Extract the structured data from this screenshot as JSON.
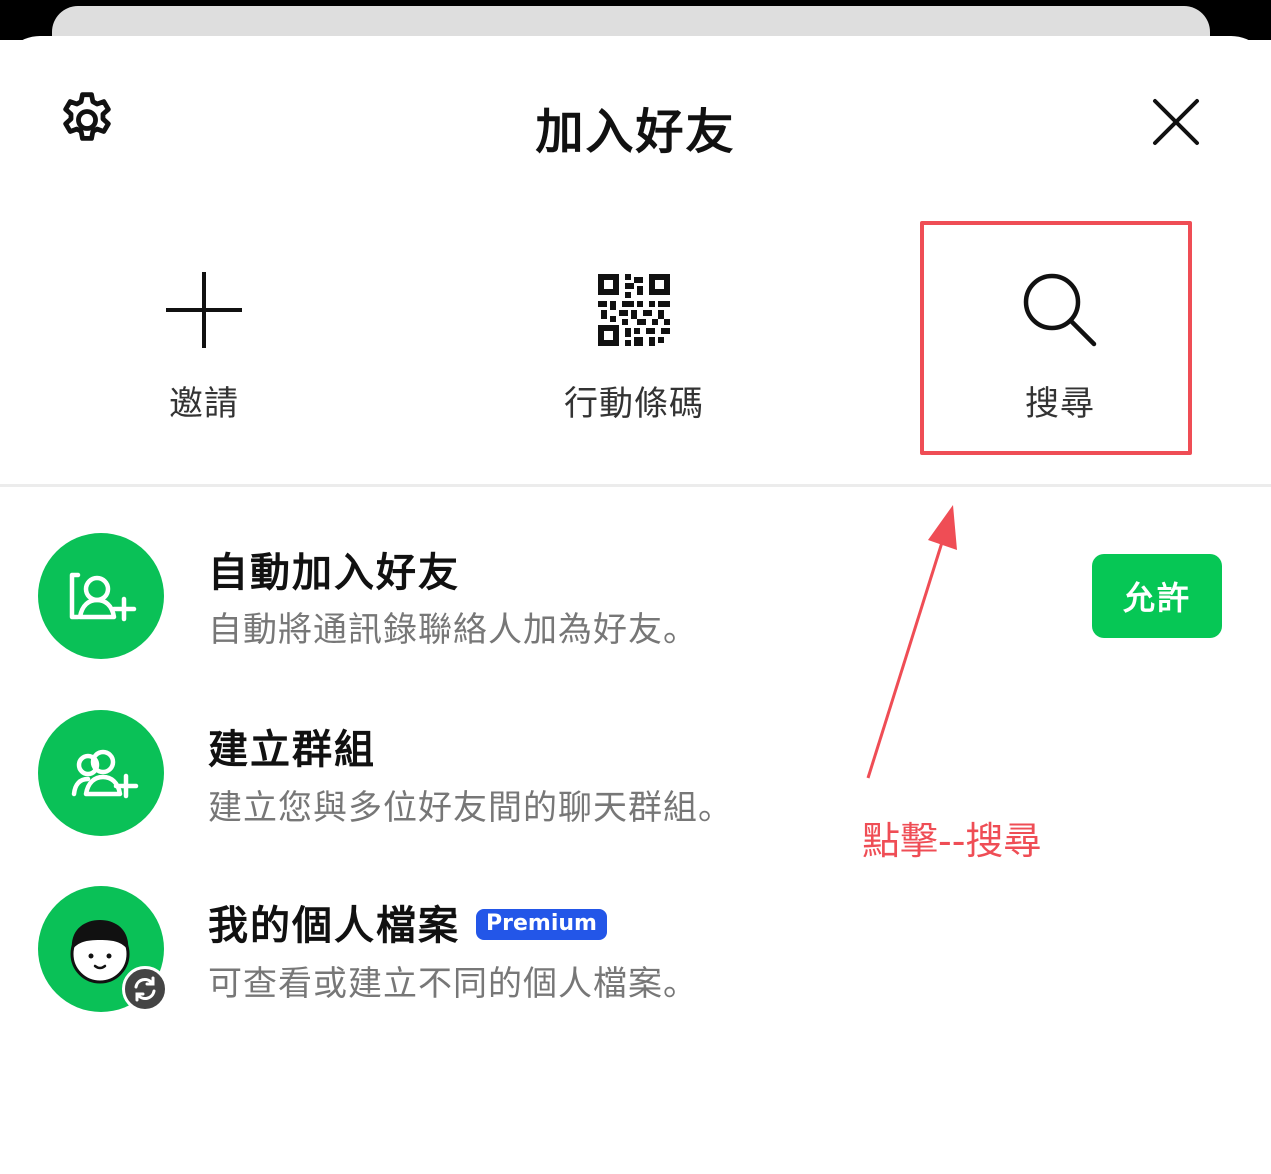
{
  "header": {
    "title": "加入好友",
    "settings_icon": "gear-icon",
    "close_icon": "close-icon"
  },
  "actions": [
    {
      "label": "邀請",
      "icon": "plus-icon"
    },
    {
      "label": "行動條碼",
      "icon": "qr-code-icon"
    },
    {
      "label": "搜尋",
      "icon": "search-icon"
    }
  ],
  "rows": [
    {
      "title": "自動加入好友",
      "subtitle": "自動將通訊錄聯絡人加為好友。",
      "button": "允許",
      "icon": "add-friend-icon"
    },
    {
      "title": "建立群組",
      "subtitle": "建立您與多位好友間的聊天群組。",
      "icon": "create-group-icon"
    },
    {
      "title": "我的個人檔案",
      "badge": "Premium",
      "subtitle": "可查看或建立不同的個人檔案。",
      "icon": "profile-avatar-icon"
    }
  ],
  "annotation": {
    "text": "點擊--搜尋"
  },
  "colors": {
    "accent_green": "#06c755",
    "highlight_red": "#ef4d55",
    "premium_blue": "#2356e8"
  }
}
